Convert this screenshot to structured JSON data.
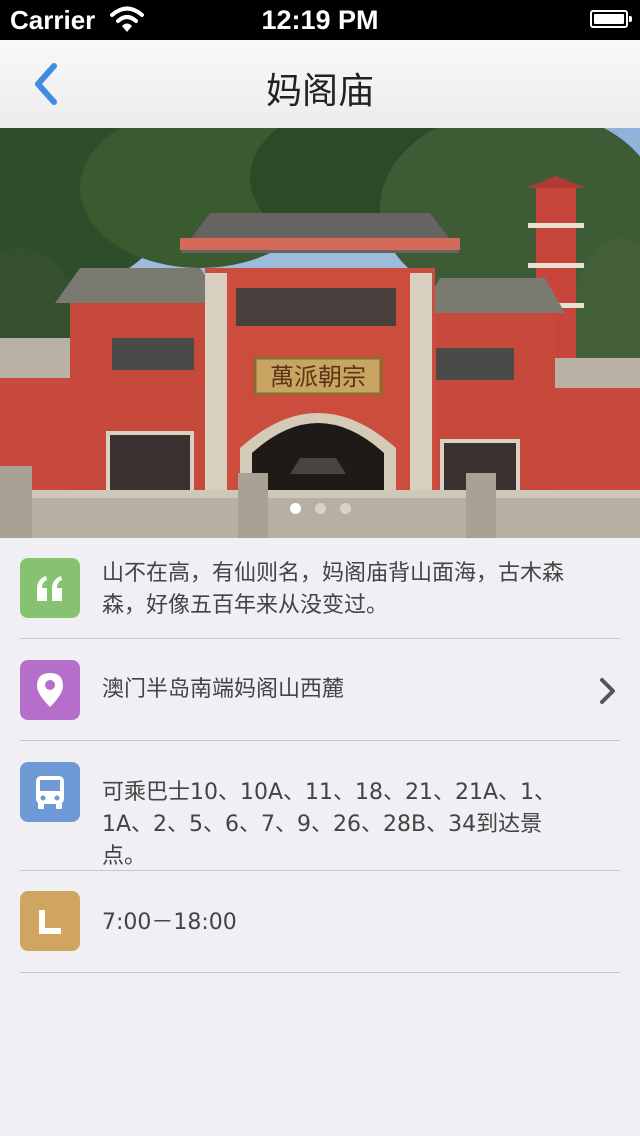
{
  "status_bar": {
    "carrier": "Carrier",
    "time": "12:19 PM"
  },
  "nav": {
    "title": "妈阁庙",
    "back_icon": "chevron-left-icon"
  },
  "hero": {
    "plaque_text": "萬派朝宗",
    "page_count": 3,
    "active_page": 1
  },
  "info": {
    "quote": {
      "icon": "quote-icon",
      "icon_color": "#86c26f",
      "line1": "山不在高，有仙则名，妈阁庙背山面海，古木森",
      "line2": "森，好像五百年来从没变过。"
    },
    "location": {
      "icon": "map-pin-icon",
      "icon_color": "#b56ec9",
      "text": "澳门半岛南端妈阁山西麓"
    },
    "bus": {
      "icon": "bus-icon",
      "icon_color": "#6d99d4",
      "line1": "可乘巴士10、10A、11、18、21、21A、1、",
      "line2": "1A、2、5、6、7、9、26、28B、34到达景点。"
    },
    "hours": {
      "icon": "clock-icon",
      "icon_color": "#cfa560",
      "text": "7:00－18:00"
    }
  },
  "colors": {
    "accent_blue": "#3f8de0",
    "background": "#efeff4"
  }
}
